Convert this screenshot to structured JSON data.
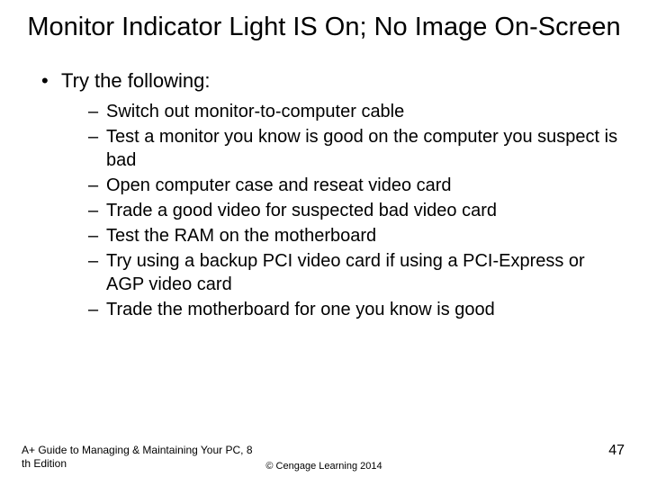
{
  "title": "Monitor Indicator Light IS On; No Image On-Screen",
  "bullets": {
    "lead": "Try the following:",
    "items": [
      "Switch out monitor-to-computer cable",
      "Test a monitor you know is good on the computer you suspect is bad",
      "Open computer case and reseat video card",
      "Trade a good video for suspected bad video card",
      "Test the RAM on the motherboard",
      "Try using a backup PCI video card if using a PCI-Express or AGP video card",
      "Trade the motherboard for one you know is good"
    ]
  },
  "footer": {
    "left": "A+ Guide to Managing & Maintaining Your PC, 8 th Edition",
    "center": "© Cengage Learning  2014",
    "page": "47"
  }
}
